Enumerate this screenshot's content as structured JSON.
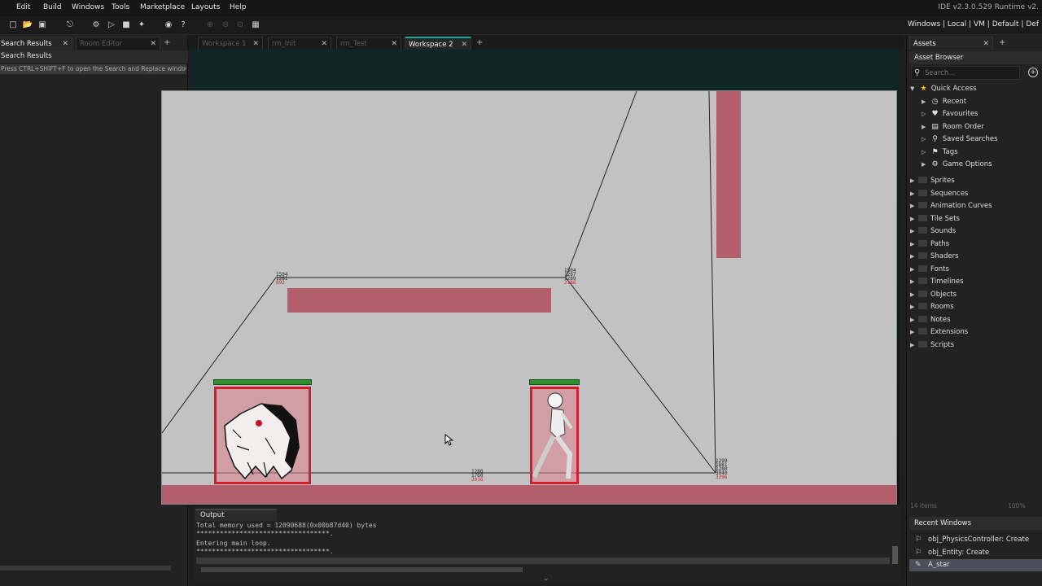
{
  "menu": {
    "items": [
      "Edit",
      "Build",
      "Windows",
      "Tools",
      "Marketplace",
      "Layouts",
      "Help"
    ]
  },
  "ide_version": "IDE v2.3.0.529  Runtime v2.",
  "target_bar": {
    "items": [
      "Windows",
      "Local",
      "VM",
      "Default",
      "Def"
    ]
  },
  "left_panel": {
    "tabs": [
      {
        "label": "Search Results"
      },
      {
        "label": "Room Editor"
      }
    ],
    "header": "Search Results",
    "hint": "Press CTRL+SHIFT+F to open the Search and Replace window."
  },
  "workspace_tabs": [
    {
      "label": "Workspace 1",
      "active": false
    },
    {
      "label": "rm_Init",
      "active": false
    },
    {
      "label": "rm_Test",
      "active": false
    },
    {
      "label": "Workspace 2",
      "active": true
    }
  ],
  "room": {
    "node_labels": [
      {
        "lines": [
          "1504",
          "1281"
        ],
        "red": "892"
      },
      {
        "lines": [
          "1504",
          "1297",
          "1289"
        ],
        "red": "2186"
      },
      {
        "lines": [
          "1280",
          "1760"
        ],
        "red": "2016"
      },
      {
        "lines": [
          "1299",
          "1881",
          "1280",
          "3040"
        ],
        "red": "3296"
      }
    ]
  },
  "output": {
    "tab": "Output",
    "lines": [
      "Total memory used = 12090688(0x00b87d40) bytes",
      "**********************************.",
      "Entering main loop.",
      "**********************************."
    ]
  },
  "assets": {
    "tab": "Assets",
    "header": "Asset Browser",
    "search_placeholder": "Search...",
    "quick_access": {
      "label": "Quick Access",
      "items": [
        {
          "label": "Recent",
          "icon": "clock-icon"
        },
        {
          "label": "Favourites",
          "icon": "heart-icon"
        },
        {
          "label": "Room Order",
          "icon": "room-order-icon"
        },
        {
          "label": "Saved Searches",
          "icon": "search-icon"
        },
        {
          "label": "Tags",
          "icon": "tag-icon"
        },
        {
          "label": "Game Options",
          "icon": "gear-icon"
        }
      ]
    },
    "folders": [
      "Sprites",
      "Sequences",
      "Animation Curves",
      "Tile Sets",
      "Sounds",
      "Paths",
      "Shaders",
      "Fonts",
      "Timelines",
      "Objects",
      "Rooms",
      "Notes",
      "Extensions",
      "Scripts"
    ],
    "count": "14 items",
    "zoom": "100%"
  },
  "recent_windows": {
    "header": "Recent Windows",
    "items": [
      {
        "label": "obj_PhysicsController: Create",
        "selected": false
      },
      {
        "label": "obj_Entity: Create",
        "selected": false
      },
      {
        "label": "A_star",
        "selected": true
      }
    ]
  },
  "colors": {
    "accent": "#1aa89a",
    "platform": "#b35f6b",
    "entity_border": "#d81a2e",
    "health": "#2f8f2f",
    "room_bg": "#c2c2c2"
  }
}
